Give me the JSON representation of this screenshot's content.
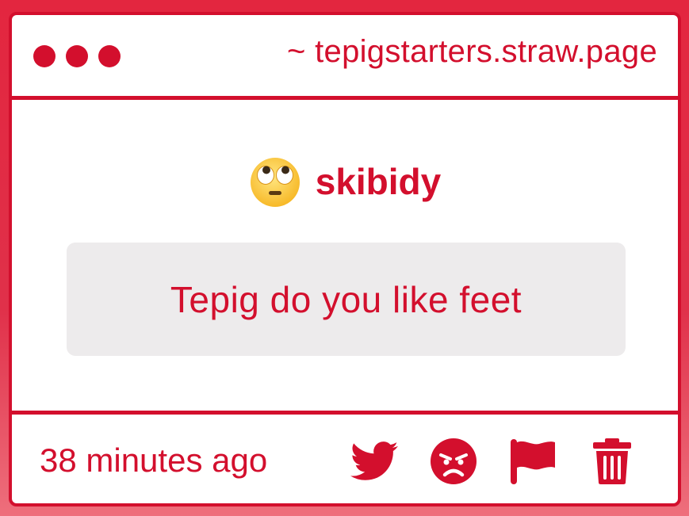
{
  "window": {
    "url": "~ tepigstarters.straw.page"
  },
  "post": {
    "author_icon": "face-with-rolling-eyes-icon",
    "author": "skibidy",
    "message": "Tepig do you like feet"
  },
  "footer": {
    "timestamp": "38 minutes ago",
    "actions": [
      {
        "name": "share-twitter",
        "icon": "twitter-bird-icon"
      },
      {
        "name": "react-angry",
        "icon": "angry-face-icon"
      },
      {
        "name": "report",
        "icon": "flag-icon"
      },
      {
        "name": "delete",
        "icon": "trash-icon"
      }
    ]
  },
  "colors": {
    "accent": "#d30f2d",
    "background": "#e3263f",
    "message_bg": "#edebec",
    "card_bg": "#ffffff"
  }
}
